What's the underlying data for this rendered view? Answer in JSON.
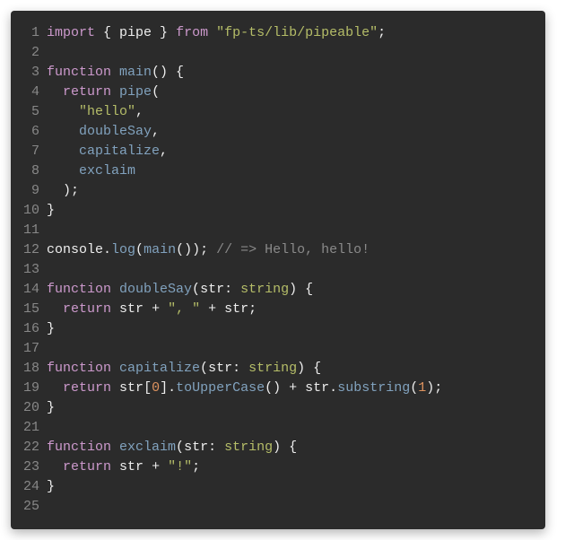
{
  "lines": [
    {
      "n": "1",
      "tokens": [
        [
          "kw",
          "import"
        ],
        [
          "punc",
          " { "
        ],
        [
          "id",
          "pipe"
        ],
        [
          "punc",
          " } "
        ],
        [
          "kw",
          "from"
        ],
        [
          "punc",
          " "
        ],
        [
          "str",
          "\"fp-ts/lib/pipeable\""
        ],
        [
          "punc",
          ";"
        ]
      ]
    },
    {
      "n": "2",
      "tokens": []
    },
    {
      "n": "3",
      "tokens": [
        [
          "kw",
          "function"
        ],
        [
          "punc",
          " "
        ],
        [
          "fn",
          "main"
        ],
        [
          "punc",
          "() {"
        ]
      ]
    },
    {
      "n": "4",
      "tokens": [
        [
          "punc",
          "  "
        ],
        [
          "kw",
          "return"
        ],
        [
          "punc",
          " "
        ],
        [
          "fn",
          "pipe"
        ],
        [
          "punc",
          "("
        ]
      ]
    },
    {
      "n": "5",
      "tokens": [
        [
          "punc",
          "    "
        ],
        [
          "str",
          "\"hello\""
        ],
        [
          "punc",
          ","
        ]
      ]
    },
    {
      "n": "6",
      "tokens": [
        [
          "punc",
          "    "
        ],
        [
          "fn",
          "doubleSay"
        ],
        [
          "punc",
          ","
        ]
      ]
    },
    {
      "n": "7",
      "tokens": [
        [
          "punc",
          "    "
        ],
        [
          "fn",
          "capitalize"
        ],
        [
          "punc",
          ","
        ]
      ]
    },
    {
      "n": "8",
      "tokens": [
        [
          "punc",
          "    "
        ],
        [
          "fn",
          "exclaim"
        ]
      ]
    },
    {
      "n": "9",
      "tokens": [
        [
          "punc",
          "  );"
        ]
      ]
    },
    {
      "n": "10",
      "tokens": [
        [
          "punc",
          "}"
        ]
      ]
    },
    {
      "n": "11",
      "tokens": []
    },
    {
      "n": "12",
      "tokens": [
        [
          "obj",
          "console"
        ],
        [
          "punc",
          "."
        ],
        [
          "prop",
          "log"
        ],
        [
          "punc",
          "("
        ],
        [
          "fn",
          "main"
        ],
        [
          "punc",
          "()); "
        ],
        [
          "cmt",
          "// => Hello, hello!"
        ]
      ]
    },
    {
      "n": "13",
      "tokens": []
    },
    {
      "n": "14",
      "tokens": [
        [
          "kw",
          "function"
        ],
        [
          "punc",
          " "
        ],
        [
          "fn",
          "doubleSay"
        ],
        [
          "punc",
          "("
        ],
        [
          "id",
          "str"
        ],
        [
          "punc",
          ": "
        ],
        [
          "type",
          "string"
        ],
        [
          "punc",
          ") {"
        ]
      ]
    },
    {
      "n": "15",
      "tokens": [
        [
          "punc",
          "  "
        ],
        [
          "kw",
          "return"
        ],
        [
          "punc",
          " "
        ],
        [
          "id",
          "str"
        ],
        [
          "punc",
          " + "
        ],
        [
          "str",
          "\", \""
        ],
        [
          "punc",
          " + "
        ],
        [
          "id",
          "str"
        ],
        [
          "punc",
          ";"
        ]
      ]
    },
    {
      "n": "16",
      "tokens": [
        [
          "punc",
          "}"
        ]
      ]
    },
    {
      "n": "17",
      "tokens": []
    },
    {
      "n": "18",
      "tokens": [
        [
          "kw",
          "function"
        ],
        [
          "punc",
          " "
        ],
        [
          "fn",
          "capitalize"
        ],
        [
          "punc",
          "("
        ],
        [
          "id",
          "str"
        ],
        [
          "punc",
          ": "
        ],
        [
          "type",
          "string"
        ],
        [
          "punc",
          ") {"
        ]
      ]
    },
    {
      "n": "19",
      "tokens": [
        [
          "punc",
          "  "
        ],
        [
          "kw",
          "return"
        ],
        [
          "punc",
          " "
        ],
        [
          "id",
          "str"
        ],
        [
          "punc",
          "["
        ],
        [
          "num",
          "0"
        ],
        [
          "punc",
          "]."
        ],
        [
          "fn",
          "toUpperCase"
        ],
        [
          "punc",
          "() + "
        ],
        [
          "id",
          "str"
        ],
        [
          "punc",
          "."
        ],
        [
          "fn",
          "substring"
        ],
        [
          "punc",
          "("
        ],
        [
          "num",
          "1"
        ],
        [
          "punc",
          ");"
        ]
      ]
    },
    {
      "n": "20",
      "tokens": [
        [
          "punc",
          "}"
        ]
      ]
    },
    {
      "n": "21",
      "tokens": []
    },
    {
      "n": "22",
      "tokens": [
        [
          "kw",
          "function"
        ],
        [
          "punc",
          " "
        ],
        [
          "fn",
          "exclaim"
        ],
        [
          "punc",
          "("
        ],
        [
          "id",
          "str"
        ],
        [
          "punc",
          ": "
        ],
        [
          "type",
          "string"
        ],
        [
          "punc",
          ") {"
        ]
      ]
    },
    {
      "n": "23",
      "tokens": [
        [
          "punc",
          "  "
        ],
        [
          "kw",
          "return"
        ],
        [
          "punc",
          " "
        ],
        [
          "id",
          "str"
        ],
        [
          "punc",
          " + "
        ],
        [
          "str",
          "\"!\""
        ],
        [
          "punc",
          ";"
        ]
      ]
    },
    {
      "n": "24",
      "tokens": [
        [
          "punc",
          "}"
        ]
      ]
    },
    {
      "n": "25",
      "tokens": []
    }
  ]
}
